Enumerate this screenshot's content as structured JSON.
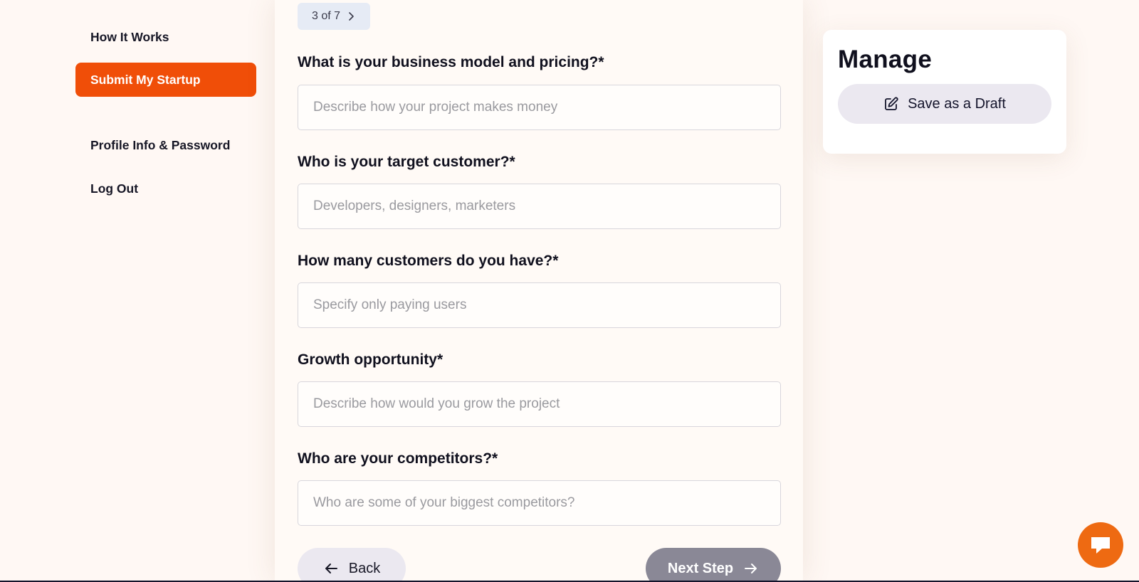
{
  "sidebar": {
    "items": [
      {
        "label": "How It Works"
      },
      {
        "label": "Submit My Startup"
      },
      {
        "label": "Profile Info & Password"
      },
      {
        "label": "Log Out"
      }
    ]
  },
  "form": {
    "step": "3 of 7",
    "fields": [
      {
        "label": "What is your business model and pricing?*",
        "placeholder": "Describe how your project makes money",
        "value": ""
      },
      {
        "label": "Who is your target customer?*",
        "placeholder": "Developers, designers, marketers",
        "value": ""
      },
      {
        "label": "How many customers do you have?*",
        "placeholder": "Specify only paying users",
        "value": ""
      },
      {
        "label": "Growth opportunity*",
        "placeholder": "Describe how would you grow the project",
        "value": ""
      },
      {
        "label": "Who are your competitors?*",
        "placeholder": "Who are some of your biggest competitors?",
        "value": ""
      }
    ],
    "back_label": "Back",
    "next_label": "Next Step"
  },
  "manage": {
    "title": "Manage",
    "draft_label": "Save as a Draft"
  },
  "icons": {
    "step": "chevron-right-icon",
    "back": "arrow-left-icon",
    "next": "arrow-right-icon",
    "draft": "edit-icon",
    "chat": "chat-icon"
  },
  "colors": {
    "accent": "#f04e08",
    "chat": "#ee6a12",
    "background": "#fff8f4",
    "next_button": "#8a8896"
  }
}
